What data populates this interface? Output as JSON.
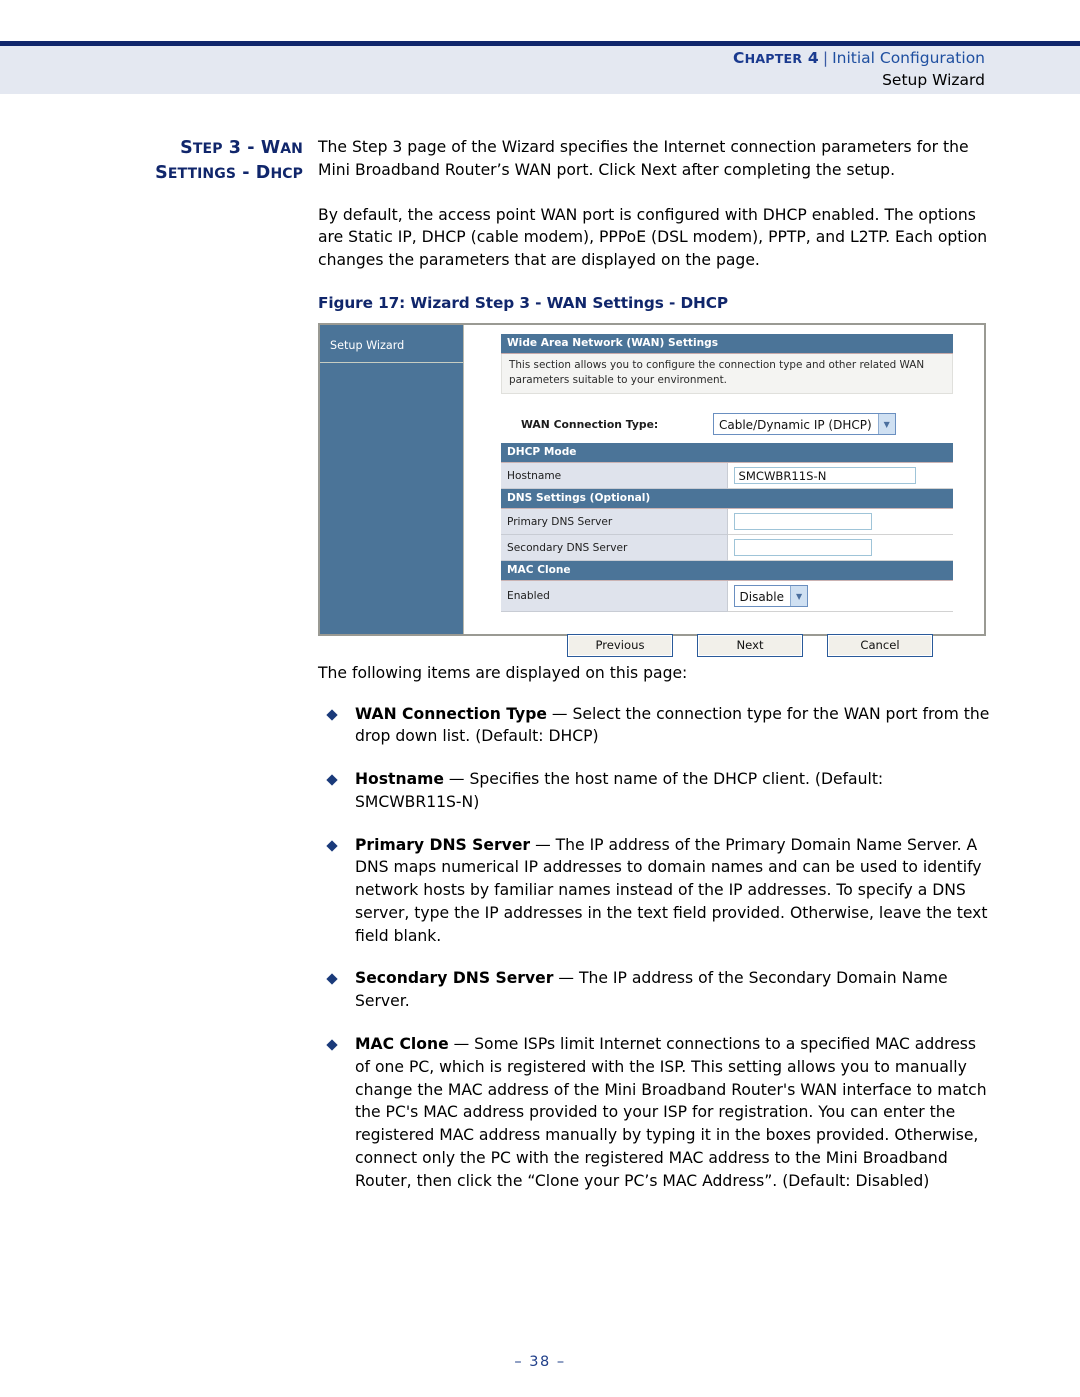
{
  "header": {
    "chapter_label": "CHAPTER 4",
    "separator": "|",
    "section": "Initial Configuration",
    "subsection": "Setup Wizard"
  },
  "side_heading": {
    "line1": "STEP 3 - WAN",
    "line2": "SETTINGS - DHCP"
  },
  "body": {
    "paragraph1": "The Step 3 page of the Wizard specifies the Internet connection parameters for the Mini Broadband Router’s WAN port. Click Next after completing the setup.",
    "paragraph2": "By default, the access point WAN port is configured with DHCP enabled. The options are Static IP, DHCP (cable modem), PPPoE (DSL modem), PPTP, and L2TP. Each option changes the parameters that are displayed on the page.",
    "figure_caption": "Figure 17:  Wizard Step 3 - WAN Settings - DHCP",
    "intro": "The following items are displayed on this page:"
  },
  "figure": {
    "sidebar_item": "Setup Wizard",
    "section_title": "Wide Area Network (WAN) Settings",
    "section_description": "This section allows you to configure the connection type and other related WAN parameters suitable to your environment.",
    "connection_type_label": "WAN Connection Type:",
    "connection_type_value": "Cable/Dynamic IP (DHCP)",
    "dhcp_mode_header": "DHCP Mode",
    "hostname_label": "Hostname",
    "hostname_value": "SMCWBR11S-N",
    "dns_header": "DNS Settings (Optional)",
    "primary_dns_label": "Primary DNS Server",
    "primary_dns_value": "",
    "secondary_dns_label": "Secondary DNS Server",
    "secondary_dns_value": "",
    "mac_clone_header": "MAC Clone",
    "mac_clone_label": "Enabled",
    "mac_clone_value": "Disable",
    "button_previous": "Previous",
    "button_next": "Next",
    "button_cancel": "Cancel"
  },
  "bullets": [
    {
      "term": "WAN Connection Type",
      "dash": " — ",
      "text": "Select the connection type for the WAN port from the drop down list. (Default: DHCP)"
    },
    {
      "term": "Hostname",
      "dash": " — ",
      "text": "Specifies the host name of the DHCP client. (Default: SMCWBR11S-N)"
    },
    {
      "term": "Primary DNS Server",
      "dash": " — ",
      "text": "The IP address of the Primary Domain Name Server. A DNS maps numerical IP addresses to domain names and can be used to identify network hosts by familiar names instead of the IP addresses. To specify a DNS server, type the IP addresses in the text field provided. Otherwise, leave the text field blank."
    },
    {
      "term": "Secondary DNS Server",
      "dash": " — ",
      "text": "The IP address of the Secondary Domain Name Server."
    },
    {
      "term": "MAC Clone",
      "dash": " — ",
      "text": "Some ISPs limit Internet connections to a specified MAC address of one PC, which is registered with the ISP. This setting allows you to manually change the MAC address of the Mini Broadband Router's WAN interface to match the PC's MAC address provided to your ISP for registration. You can enter the registered MAC address manually by typing it in the boxes provided. Otherwise, connect only the PC with the registered MAC address to the Mini Broadband Router, then click the “Clone your PC’s MAC Address”. (Default: Disabled)"
    }
  ],
  "footer": {
    "page_number": "–  38  –"
  }
}
